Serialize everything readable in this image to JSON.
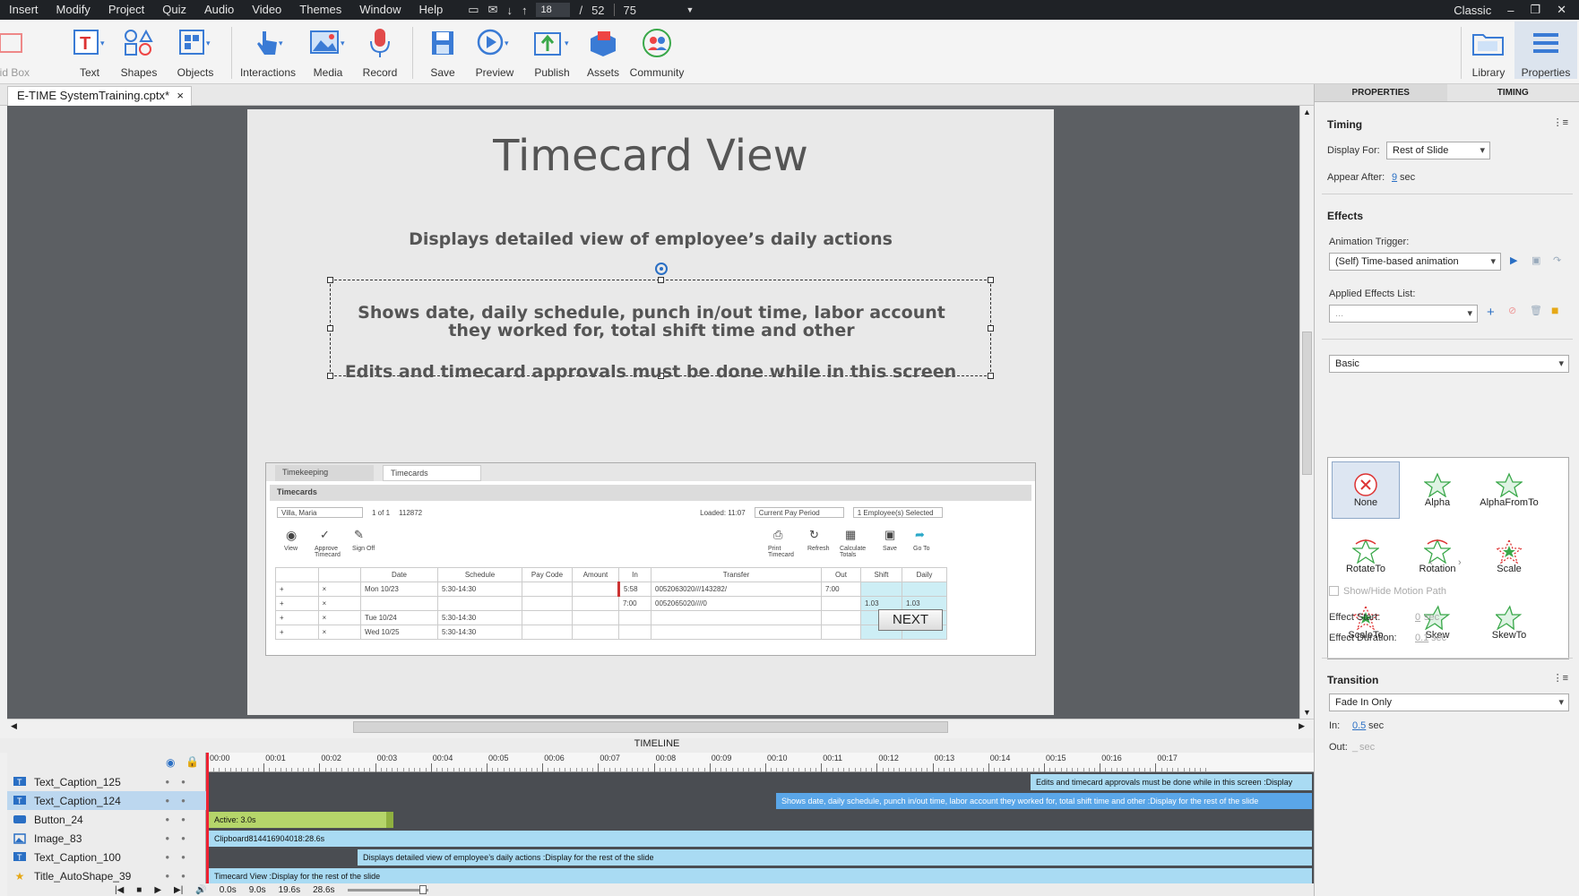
{
  "menu": [
    "Insert",
    "Modify",
    "Project",
    "Quiz",
    "Audio",
    "Video",
    "Themes",
    "Window",
    "Help"
  ],
  "menubar": {
    "slide_current": "18",
    "slide_sep": "/",
    "slide_total": "52",
    "zoom": "75",
    "workspace": "Classic"
  },
  "toolbar": {
    "partial": "uid Box",
    "items": [
      "Text",
      "Shapes",
      "Objects",
      "Interactions",
      "Media",
      "Record",
      "Save",
      "Preview",
      "Publish",
      "Assets",
      "Community"
    ],
    "right": [
      "Library",
      "Properties"
    ]
  },
  "doc_tab": {
    "name": "E-TIME SystemTraining.cptx*",
    "close": "×"
  },
  "slide": {
    "title": "Timecard View",
    "caption1": "Displays detailed view of employee’s daily actions",
    "caption2": "Shows date, daily schedule, punch in/out time, labor account they worked for, total shift time and other",
    "caption3": "Edits and timecard approvals must be done while in this screen",
    "next": "NEXT"
  },
  "screenshot": {
    "tab1": "Timekeeping",
    "tab2": "Timecards",
    "header": "Timecards",
    "filters": [
      "Villa, Maria",
      "1 of 1",
      "112872",
      "Loaded: 11:07",
      "Current Pay Period",
      "1 Employee(s) Selected"
    ],
    "icons_left": [
      "View",
      "Approve Timecard",
      "Sign Off"
    ],
    "icons_right": [
      "Print Timecard",
      "Refresh",
      "Calculate Totals",
      "Save",
      "Go To"
    ],
    "columns": [
      "",
      "",
      "Date",
      "Schedule",
      "Pay Code",
      "Amount",
      "In",
      "Transfer",
      "Out",
      "Shift",
      "Daily"
    ],
    "rows": [
      [
        "+",
        "×",
        "Mon 10/23",
        "5:30-14:30",
        "",
        "",
        "5:58",
        "0052063020///143282/",
        "7:00",
        "",
        ""
      ],
      [
        "+",
        "×",
        "",
        "",
        "",
        "",
        "7:00",
        "0052065020////0",
        "",
        "1.03",
        "1.03"
      ],
      [
        "+",
        "×",
        "Tue 10/24",
        "5:30-14:30",
        "",
        "",
        "",
        "",
        "",
        "",
        ""
      ],
      [
        "+",
        "×",
        "Wed 10/25",
        "5:30-14:30",
        "",
        "",
        "",
        "",
        "",
        "",
        ""
      ]
    ]
  },
  "timeline": {
    "title": "TIMELINE",
    "ticks": [
      "00:00",
      "00:01",
      "00:02",
      "00:03",
      "00:04",
      "00:05",
      "00:06",
      "00:07",
      "00:08",
      "00:09",
      "00:10",
      "00:11",
      "00:12",
      "00:13",
      "00:14",
      "00:15",
      "00:16",
      "00:17"
    ],
    "rows": [
      {
        "name": "Text_Caption_125",
        "bar": "Edits and timecard approvals must be done while in this screen :Display"
      },
      {
        "name": "Text_Caption_124",
        "bar": "Shows date, daily schedule, punch in/out time, labor account they worked for, total shift time and other :Display for the rest of the slide"
      },
      {
        "name": "Button_24",
        "bar": "Active: 3.0s"
      },
      {
        "name": "Image_83",
        "bar": "Clipboard814416904018:28.6s"
      },
      {
        "name": "Text_Caption_100",
        "bar": "Displays detailed view of employee’s daily actions :Display for the rest of the slide"
      },
      {
        "name": "Title_AutoShape_39",
        "bar": "Timecard View :Display for the rest of the slide"
      }
    ],
    "footer": [
      "0.0s",
      "9.0s",
      "19.6s",
      "28.6s"
    ]
  },
  "panel": {
    "tabs": [
      "PROPERTIES",
      "TIMING"
    ],
    "timing_title": "Timing",
    "display_for_label": "Display For:",
    "display_for_value": "Rest of Slide",
    "appear_after_label": "Appear After:",
    "appear_after_value": "9",
    "sec": "sec",
    "effects_title": "Effects",
    "trigger_label": "Animation Trigger:",
    "trigger_value": "(Self) Time-based animation",
    "applied_label": "Applied Effects List:",
    "applied_value": "...",
    "category": "Basic",
    "effects": [
      "None",
      "Alpha",
      "AlphaFromTo",
      "RotateTo",
      "Rotation",
      "Scale",
      "ScaleTo",
      "Skew",
      "SkewTo"
    ],
    "motion_path": "Show/Hide Motion Path",
    "effect_start_label": "Effect Start:",
    "effect_start_value": "0",
    "effect_duration_label": "Effect Duration:",
    "effect_duration_value": "0.1",
    "transition_title": "Transition",
    "transition_value": "Fade In Only",
    "in_label": "In:",
    "in_value": "0.5",
    "out_label": "Out:",
    "out_value": "_"
  },
  "colors": {
    "accent": "#2a6fc4",
    "timeline_bar": "#a9dbf3",
    "timeline_selected_bar": "#5aa6e8",
    "button_bar": "#b5d56a",
    "menubar": "#1f2226"
  }
}
